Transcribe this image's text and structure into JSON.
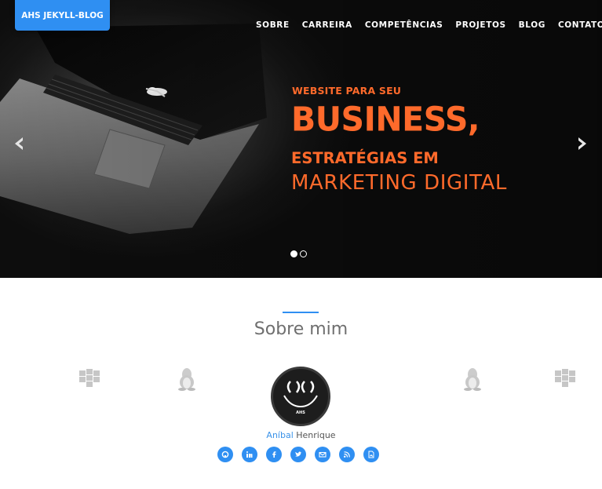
{
  "brand": {
    "label": "AHS JEKYLL-BLOG"
  },
  "nav": {
    "items": [
      {
        "label": "SOBRE"
      },
      {
        "label": "CARREIRA"
      },
      {
        "label": "COMPETÊNCIAS"
      },
      {
        "label": "PROJETOS"
      },
      {
        "label": "BLOG"
      },
      {
        "label": "CONTATOS"
      }
    ]
  },
  "hero": {
    "line1": "WEBSITE PARA SEU",
    "line2": "BUSINESS,",
    "line3": "ESTRATÉGIAS EM",
    "line4": "MARKETING DIGITAL",
    "prev_icon": "chevron-left-icon",
    "next_icon": "chevron-right-icon",
    "slides": 2,
    "active_slide": 1,
    "accent": "#ff6a2b"
  },
  "about": {
    "title": "Sobre mim",
    "first_name": "Aníbal",
    "last_name": "Henrique",
    "avatar_text": "AHS",
    "decor_icons": [
      "dropbox-icon",
      "linux-icon",
      "linux-icon",
      "dropbox-icon"
    ],
    "social_icons": [
      "github-icon",
      "linkedin-icon",
      "facebook-icon",
      "twitter-icon",
      "envelope-icon",
      "rss-icon",
      "pdf-icon"
    ]
  },
  "colors": {
    "primary": "#2f8ff2",
    "name_link": "#3a92e8",
    "heading": "#6f6f6f"
  }
}
